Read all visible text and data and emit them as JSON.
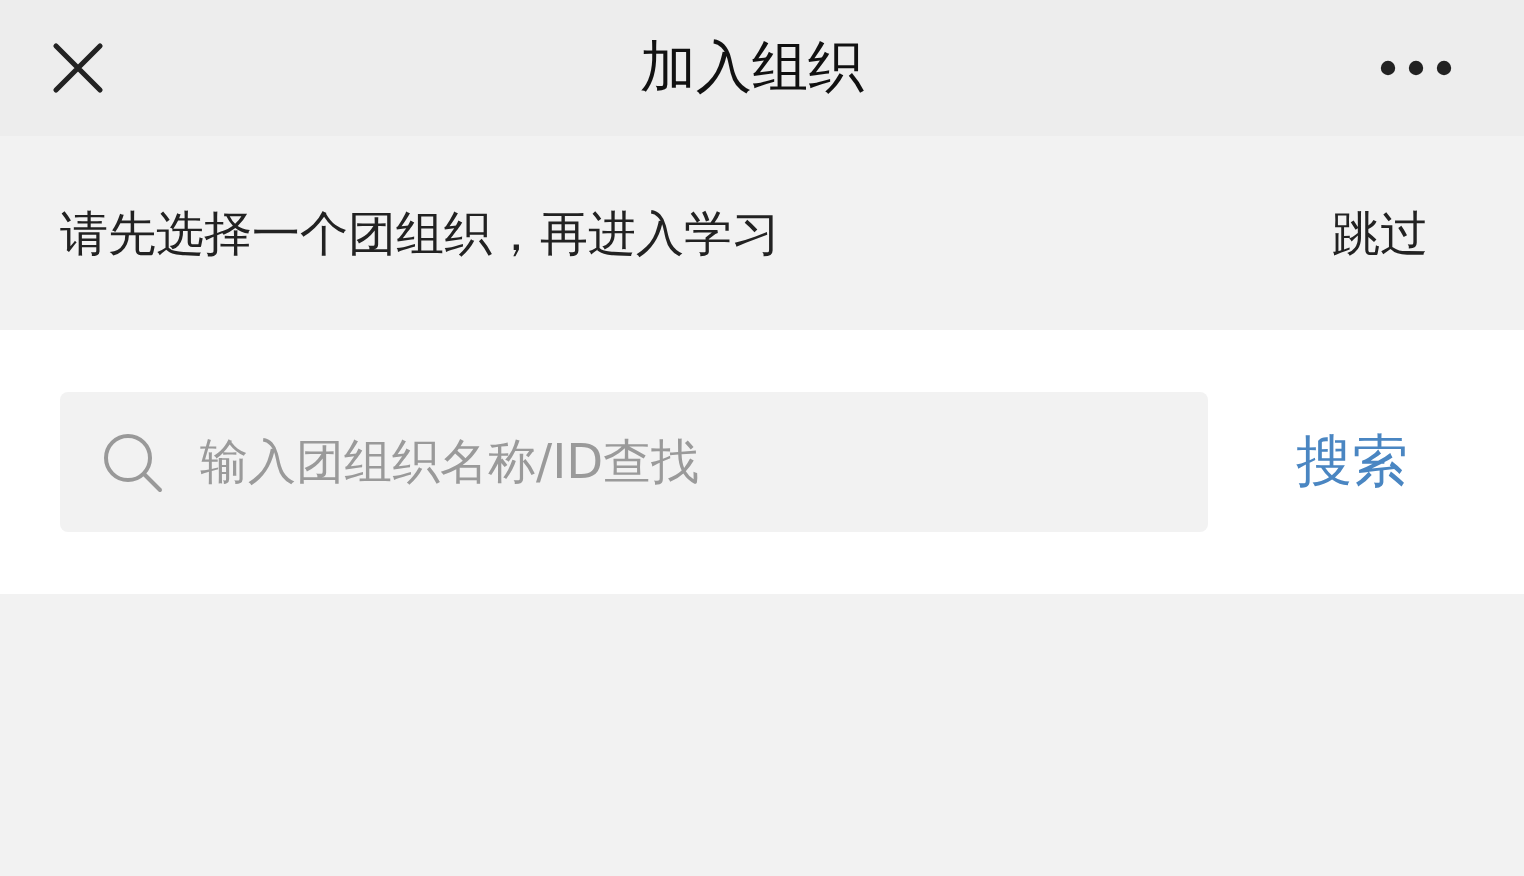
{
  "header": {
    "title": "加入组织"
  },
  "notice": {
    "text": "请先选择一个团组织，再进入学习",
    "skip": "跳过"
  },
  "search": {
    "placeholder": "输入团组织名称/ID查找",
    "button": "搜索"
  }
}
